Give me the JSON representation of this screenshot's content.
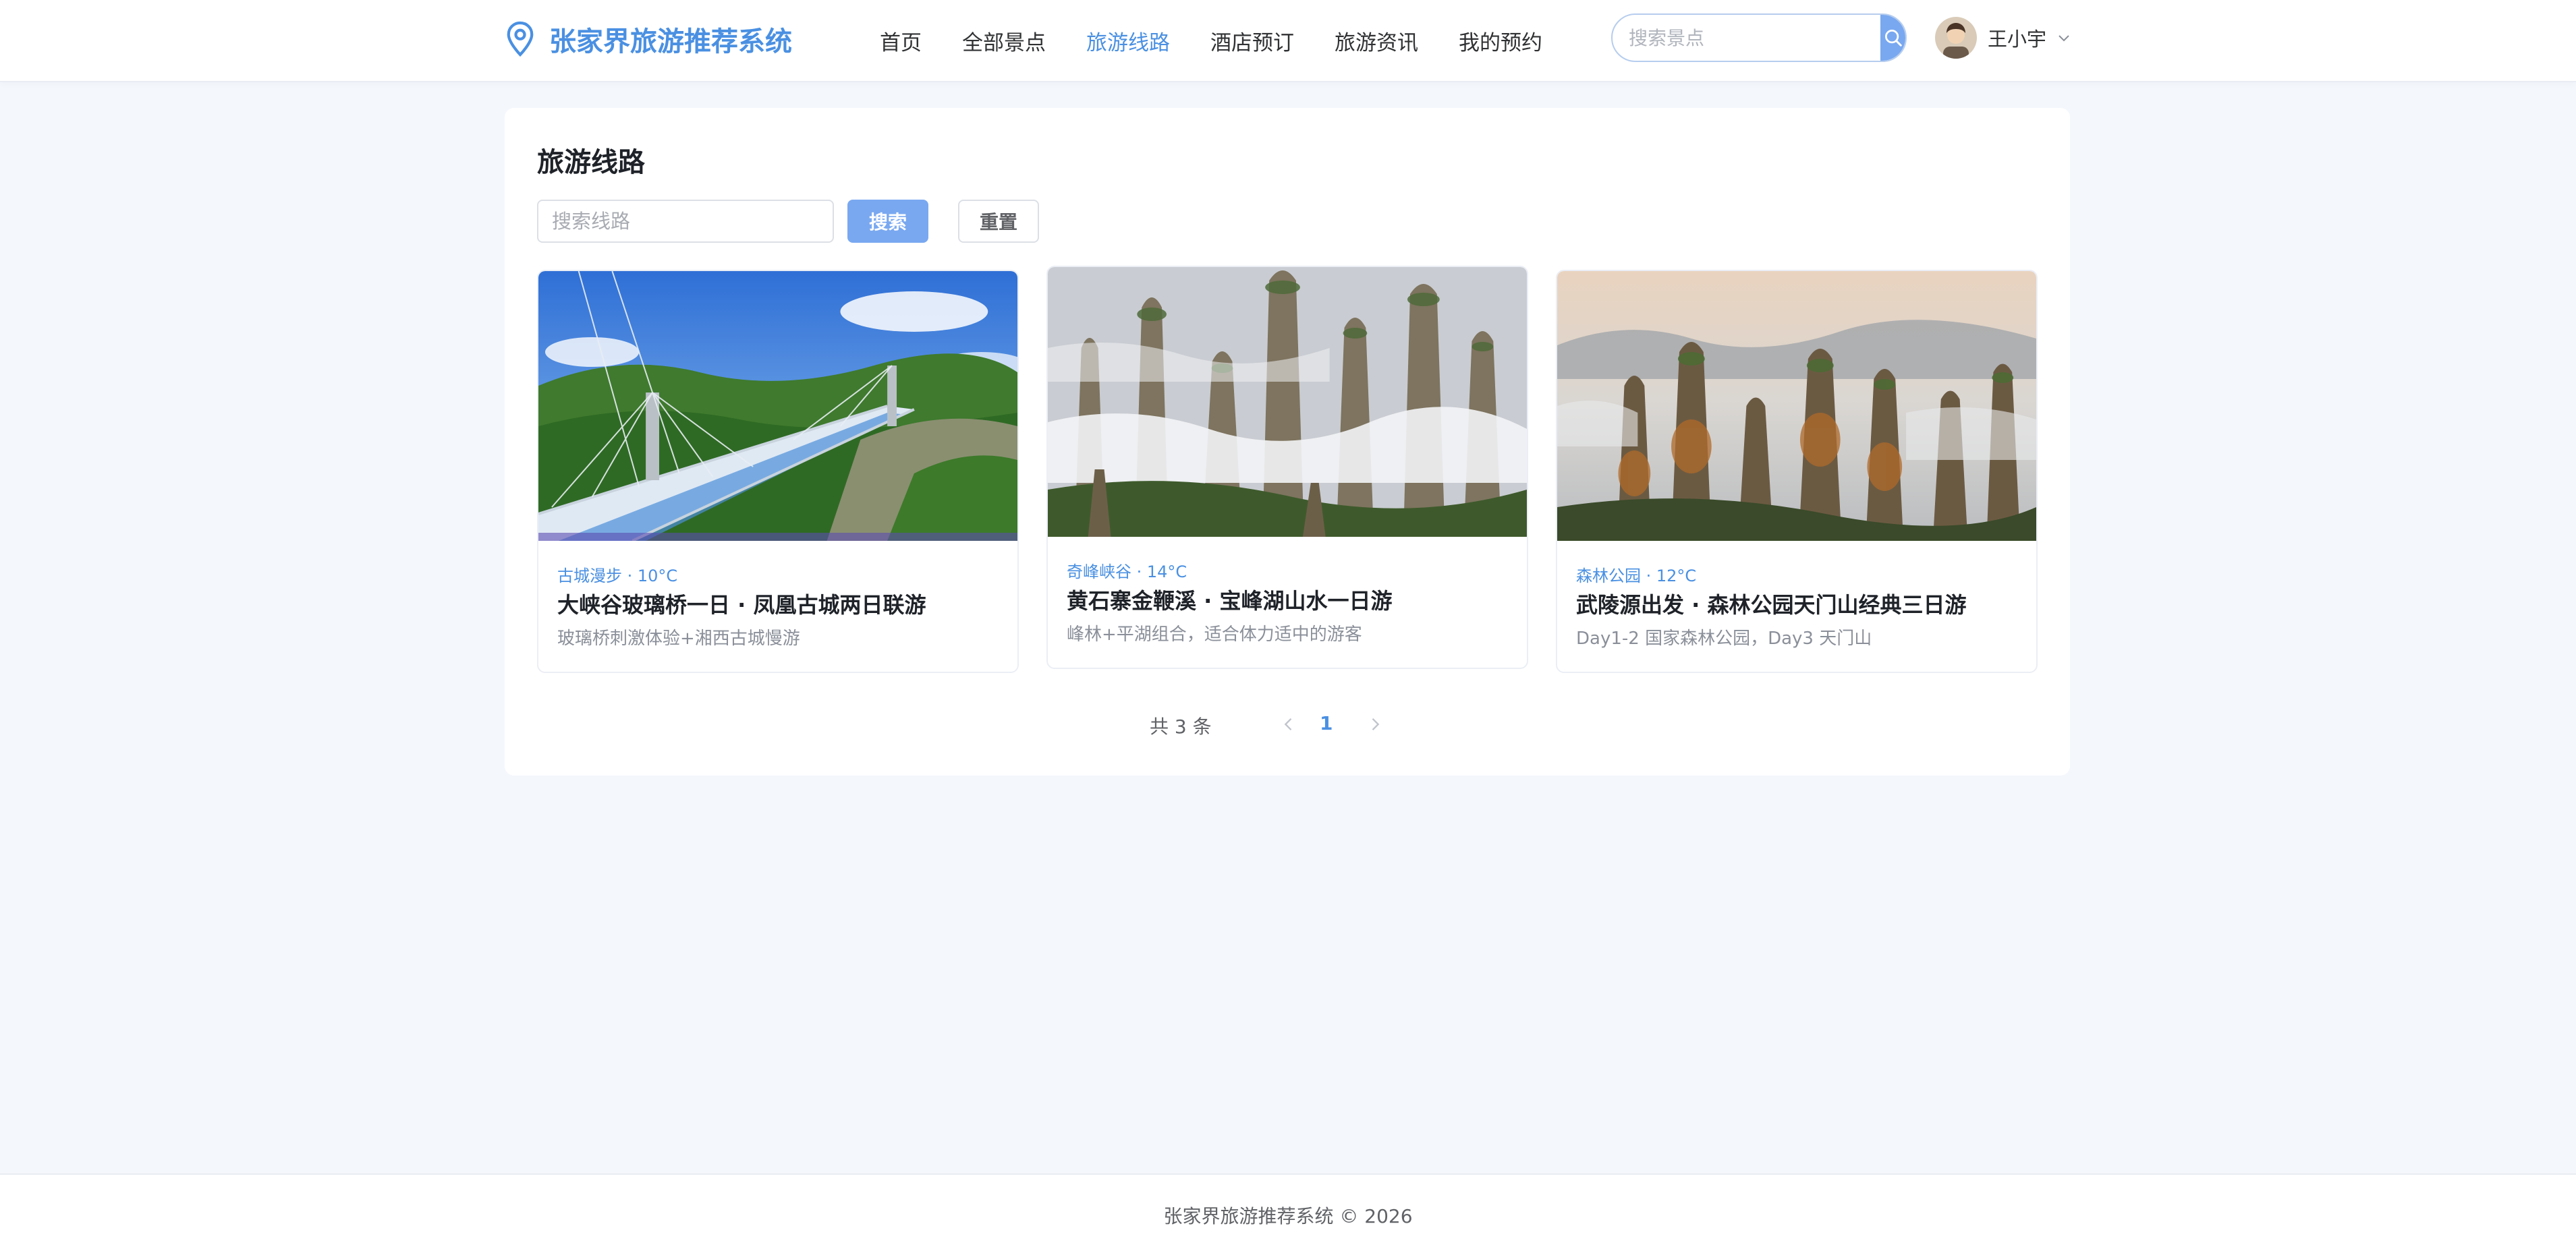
{
  "app": {
    "title": "张家界旅游推荐系统"
  },
  "nav": {
    "items": [
      {
        "label": "首页"
      },
      {
        "label": "全部景点"
      },
      {
        "label": "旅游线路",
        "active": true
      },
      {
        "label": "酒店预订"
      },
      {
        "label": "旅游资讯"
      },
      {
        "label": "我的预约"
      }
    ]
  },
  "header_search": {
    "placeholder": "搜索景点",
    "icon": "search-icon"
  },
  "user": {
    "name": "王小宇",
    "icon": "chevron-down-icon"
  },
  "page": {
    "title": "旅游线路",
    "search_placeholder": "搜索线路",
    "search_label": "搜索",
    "reset_label": "重置"
  },
  "routes": [
    {
      "meta": "古城漫步 · 10°C",
      "title": "大峡谷玻璃桥一日 · 凤凰古城两日联游",
      "desc": "玻璃桥刺激体验+湘西古城慢游"
    },
    {
      "meta": "奇峰峡谷 · 14°C",
      "title": "黄石寨金鞭溪 · 宝峰湖山水一日游",
      "desc": "峰林+平湖组合，适合体力适中的游客"
    },
    {
      "meta": "森林公园 · 12°C",
      "title": "武陵源出发 · 森林公园天门山经典三日游",
      "desc": "Day1-2 国家森林公园，Day3 天门山"
    }
  ],
  "pagination": {
    "total_text": "共 3 条",
    "current": "1"
  },
  "footer": {
    "text": "张家界旅游推荐系统 © 2026"
  },
  "colors": {
    "accent": "#4a90e2",
    "button": "#79a8f0",
    "background": "#f4f7fc"
  }
}
